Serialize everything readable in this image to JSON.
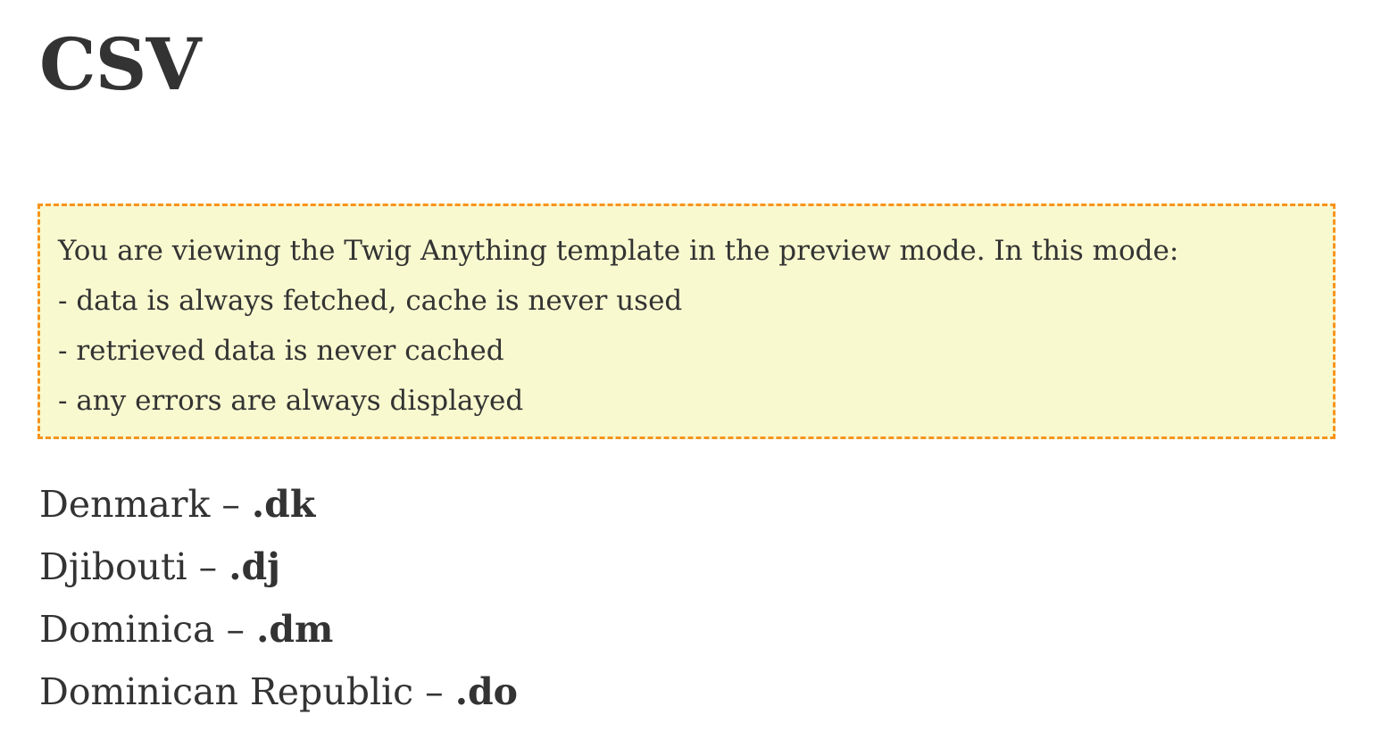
{
  "page": {
    "title": "CSV"
  },
  "notice": {
    "lines": [
      "You are viewing the Twig Anything template in the preview mode. In this mode:",
      "- data is always fetched, cache is never used",
      "- retrieved data is never cached",
      "- any errors are always displayed"
    ],
    "border_color": "#f7941d",
    "background_color": "#f8f9cf"
  },
  "countries": {
    "separator": " – ",
    "items": [
      {
        "name": "Denmark",
        "tld": ".dk"
      },
      {
        "name": "Djibouti",
        "tld": ".dj"
      },
      {
        "name": "Dominica",
        "tld": ".dm"
      },
      {
        "name": "Dominican Republic",
        "tld": ".do"
      }
    ]
  }
}
